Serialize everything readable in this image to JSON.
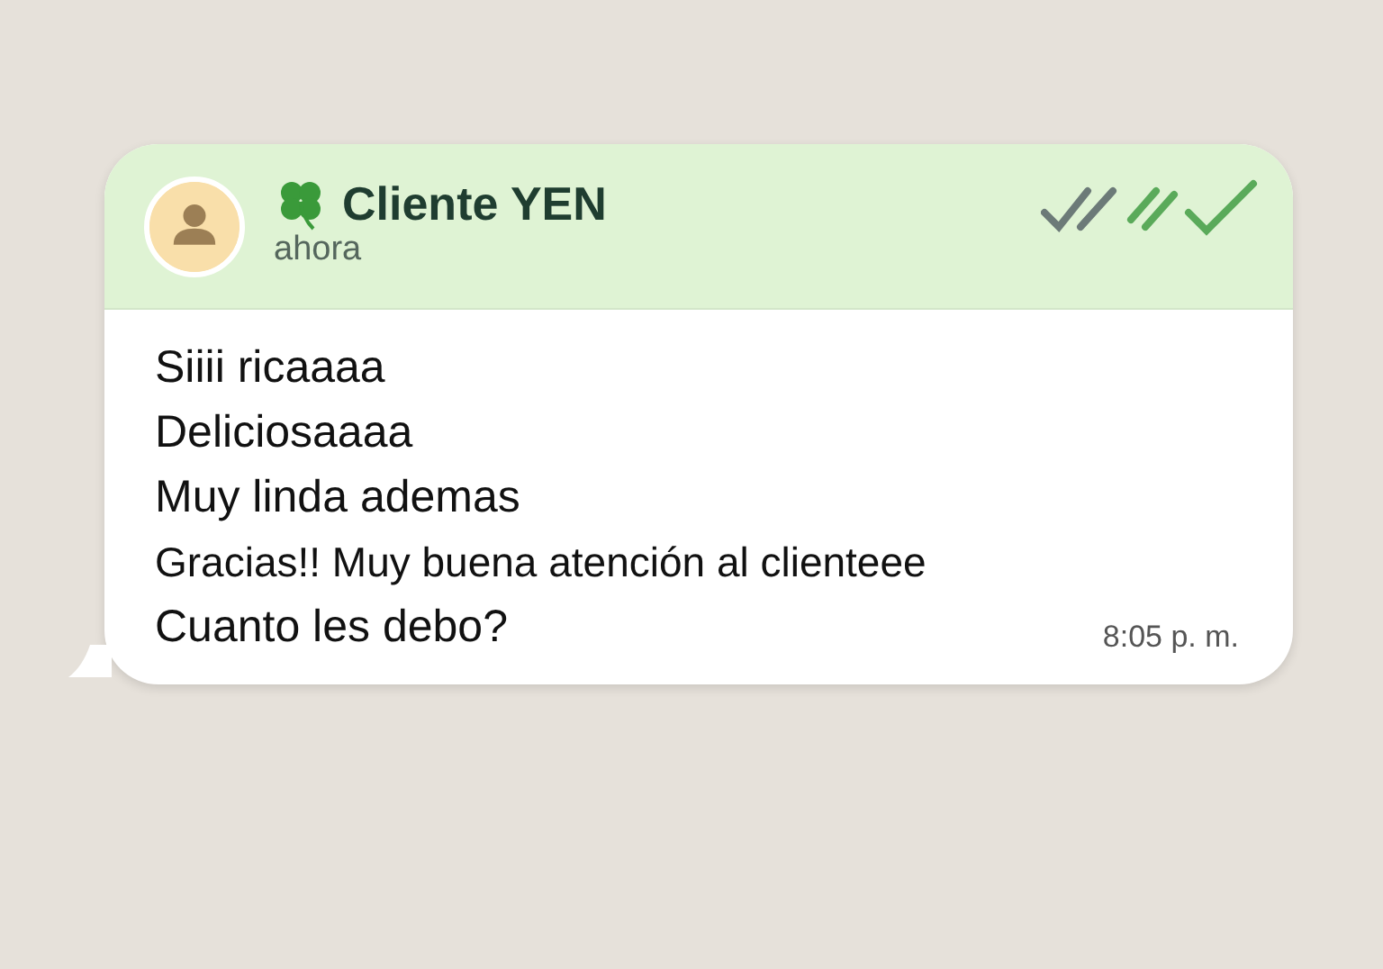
{
  "chat": {
    "contact": "Cliente YEN",
    "status": "ahora"
  },
  "messages": [
    "Siiii ricaaaa",
    "Deliciosaaaa",
    "Muy linda ademas",
    "Gracias!! Muy buena atención al clienteee",
    "Cuanto les debo?"
  ],
  "time": "8:05 p. m."
}
